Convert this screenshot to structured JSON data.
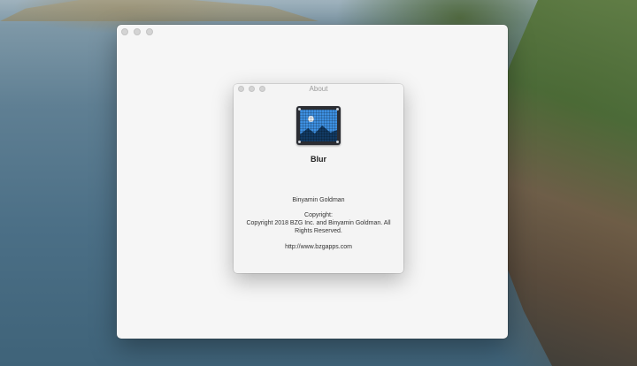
{
  "main_window": {
    "title": ""
  },
  "about_window": {
    "title": "About",
    "app_name": "Blur",
    "author": "Binyamin Goldman",
    "copyright_label": "Copyright:",
    "copyright_text": "Copyright 2018 BZG Inc. and Binyamin Goldman. All Rights Reserved.",
    "website": "http://www.bzgapps.com",
    "app_icon": "image-blur-app-icon"
  },
  "colors": {
    "window_bg": "#f6f6f6",
    "icon_blue": "#3d8fe0",
    "icon_frame": "#2b2d33"
  }
}
